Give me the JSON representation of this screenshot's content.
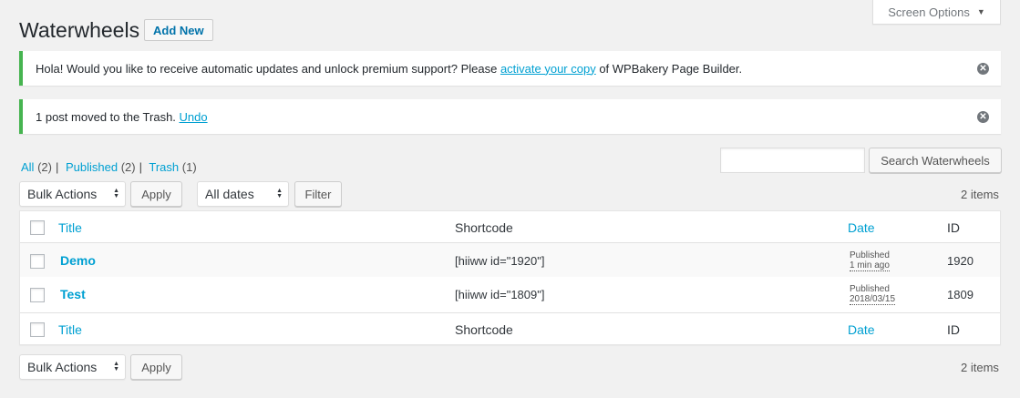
{
  "screen_options": {
    "label": "Screen Options",
    "caret": "▼"
  },
  "header": {
    "title": "Waterwheels",
    "add_new": "Add New"
  },
  "notices": [
    {
      "text_before": "Hola! Would you like to receive automatic updates and unlock premium support? Please ",
      "link": "activate your copy",
      "text_after": " of WPBakery Page Builder."
    },
    {
      "text_before": "1 post moved to the Trash. ",
      "link": "Undo"
    }
  ],
  "views": [
    {
      "label": "All",
      "count": "(2)"
    },
    {
      "label": "Published",
      "count": "(2)"
    },
    {
      "label": "Trash",
      "count": "(1)"
    }
  ],
  "search": {
    "value": "",
    "button": "Search Waterwheels"
  },
  "top_nav": {
    "bulk_actions": "Bulk Actions",
    "apply": "Apply",
    "date_filter": "All dates",
    "filter": "Filter",
    "count": "2 items"
  },
  "bottom_nav": {
    "bulk_actions": "Bulk Actions",
    "apply": "Apply",
    "count": "2 items"
  },
  "table": {
    "columns": [
      "Title",
      "Shortcode",
      "Date",
      "ID"
    ],
    "rows": [
      {
        "title": "Demo",
        "shortcode": "[hiiww id=\"1920\"]",
        "status": "Published",
        "date": "1 min ago",
        "id": "1920"
      },
      {
        "title": "Test",
        "shortcode": "[hiiww id=\"1809\"]",
        "status": "Published",
        "date": "2018/03/15",
        "id": "1809"
      }
    ]
  },
  "colors": {
    "accent": "#00a0d2",
    "link": "#0073aa",
    "notice_border": "#46b450",
    "background": "#f1f1f1"
  }
}
